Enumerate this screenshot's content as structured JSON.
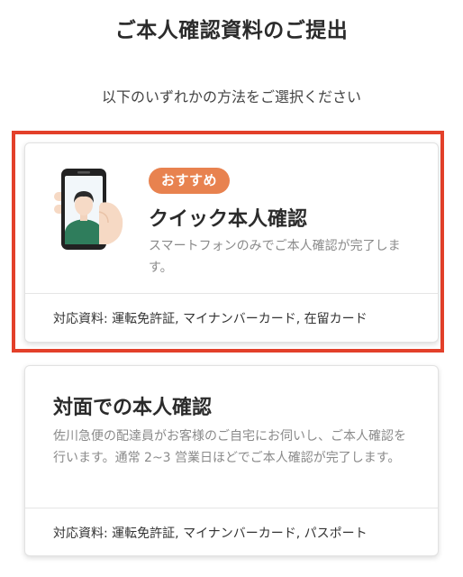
{
  "header": {
    "title": "ご本人確認資料のご提出",
    "subtitle": "以下のいずれかの方法をご選択ください"
  },
  "options": {
    "quick": {
      "badge": "おすすめ",
      "title": "クイック本人確認",
      "description": "スマートフォンのみでご本人確認が完了します。",
      "documents": "対応資料: 運転免許証, マイナンバーカード, 在留カード",
      "illustration": "smartphone-selfie-icon",
      "highlighted": true
    },
    "face_to_face": {
      "title": "対面での本人確認",
      "description": "佐川急便の配達員がお客様のご自宅にお伺いし、ご本人確認を行います。通常 2~3 営業日ほどでご本人確認が完了します。",
      "documents": "対応資料: 運転免許証, マイナンバーカード, パスポート"
    }
  },
  "colors": {
    "highlight_border": "#e3402a",
    "badge_background": "#e8824f",
    "phone_shirt": "#2f7d5c"
  }
}
